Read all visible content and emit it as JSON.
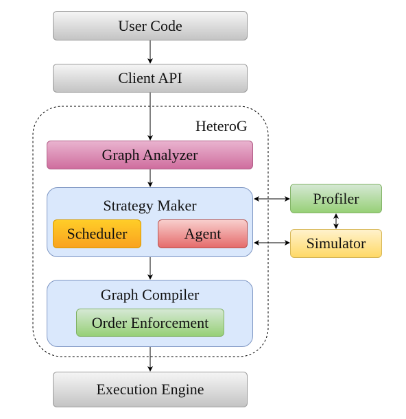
{
  "nodes": {
    "user_code": "User Code",
    "client_api": "Client API",
    "heterog": "HeteroG",
    "graph_analyzer": "Graph Analyzer",
    "strategy_maker": "Strategy Maker",
    "scheduler": "Scheduler",
    "agent": "Agent",
    "profiler": "Profiler",
    "simulator": "Simulator",
    "graph_compiler": "Graph Compiler",
    "order_enforcement": "Order Enforcement",
    "execution_engine": "Execution Engine"
  }
}
